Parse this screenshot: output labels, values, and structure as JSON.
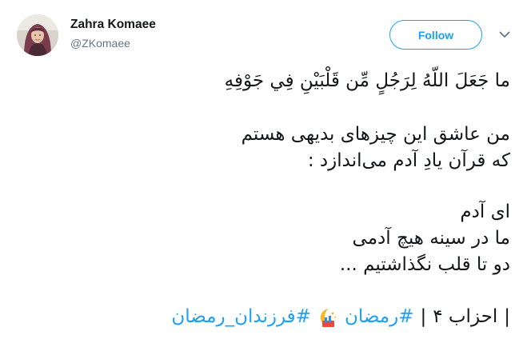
{
  "author": {
    "name": "Zahra Komaee",
    "handle": "@ZKomaee",
    "avatar_icon": "user-avatar"
  },
  "follow_button": {
    "label": "Follow"
  },
  "menu": {
    "icon": "chevron-down-icon"
  },
  "tweet": {
    "lines": [
      "ما جَعَلَ اللّهُ لِرَجُلٍ مِّن قَلْبَيْنِ فِي جَوْفِهِ",
      "من عاشق این چیزهای بدیهی هستم",
      "که قرآن یادِ آدم می‌اندازد :",
      "ای آدم",
      "ما در سینه هیچ آدمی",
      "دو تا قلب نگذاشتیم ..."
    ],
    "footer": {
      "reference": "احزاب ۴",
      "separator_1": "|",
      "separator_2": "|",
      "hashtag_1": "#رمضان",
      "emoji_icon": "crescent-moon-emoji-icon",
      "hashtag_2": "#فرزندان_رمضان"
    }
  },
  "colors": {
    "accent": "#1da1f2",
    "text": "#14171a",
    "muted": "#657786"
  }
}
